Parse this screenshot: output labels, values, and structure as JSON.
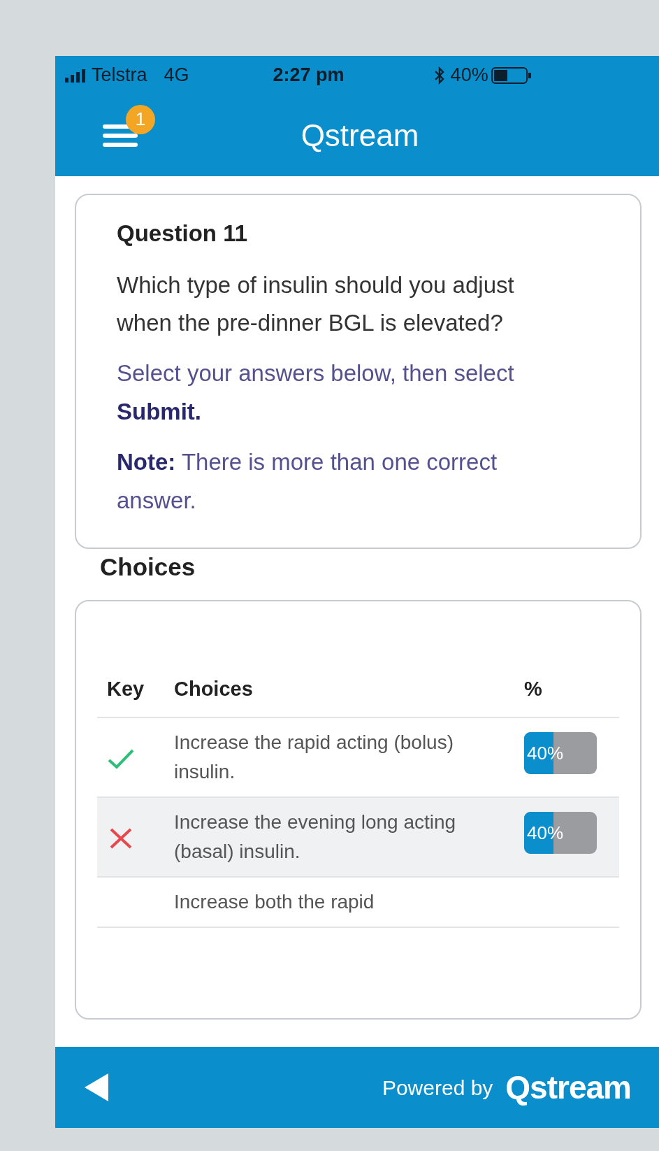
{
  "status_bar": {
    "carrier": "Telstra",
    "network": "4G",
    "time": "2:27 pm",
    "battery": "40%"
  },
  "header": {
    "title": "Qstream",
    "badge": "1"
  },
  "question": {
    "title": "Question 11",
    "text": "Which type of insulin should you adjust when the pre-dinner BGL is elevated?",
    "instruction": "Select your answers below, then select **Submit.**",
    "note": "**Note:** There is more than one correct answer."
  },
  "choices": {
    "heading": "Choices",
    "columns": [
      "Key",
      "Choices",
      "%"
    ],
    "rows": [
      {
        "key": {
          "kind": "correct"
        },
        "text": "Increase the rapid acting (bolus) insulin.",
        "percent": {
          "label": "40%",
          "level": 0.4
        }
      },
      {
        "key": {
          "kind": "incorrect"
        },
        "text": "Increase the evening long acting (basal) insulin.",
        "percent": {
          "label": "40%",
          "level": 0.4
        }
      },
      {
        "text": "Increase both the rapid"
      }
    ]
  },
  "footer": {
    "powered_by": "Powered by",
    "logo": "Qstream"
  }
}
